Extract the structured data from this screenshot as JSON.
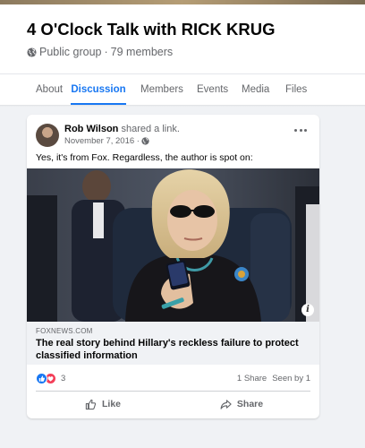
{
  "group": {
    "title": "4 O'Clock Talk with RICK KRUG",
    "privacy": "Public group",
    "separator": "·",
    "members": "79 members"
  },
  "tabs": [
    {
      "label": "About"
    },
    {
      "label": "Discussion",
      "active": true
    },
    {
      "label": "Members"
    },
    {
      "label": "Events"
    },
    {
      "label": "Media"
    },
    {
      "label": "Files"
    }
  ],
  "post": {
    "author": "Rob Wilson",
    "action": "shared a link.",
    "date": "November 7, 2016 ·",
    "text": "Yes, it's from Fox.  Regardless, the author is spot on:",
    "link": {
      "domain": "FOXNEWS.COM",
      "title": "The real story behind Hillary's reckless failure to protect classified information"
    },
    "reaction_count": "3",
    "shares": "1 Share",
    "seen_by": "Seen by 1",
    "like_label": "Like",
    "share_label": "Share"
  },
  "icons": {
    "privacy": "globe-icon",
    "more": "more-options-icon",
    "image_info": "info-icon",
    "like_reaction": "like-reaction-icon",
    "love_reaction": "love-reaction-icon",
    "like_button": "thumbs-up-icon",
    "share_button": "share-arrow-icon"
  },
  "colors": {
    "accent": "#1877f2",
    "background": "#f0f2f5",
    "text_secondary": "#65676b",
    "love": "#f33e58"
  }
}
